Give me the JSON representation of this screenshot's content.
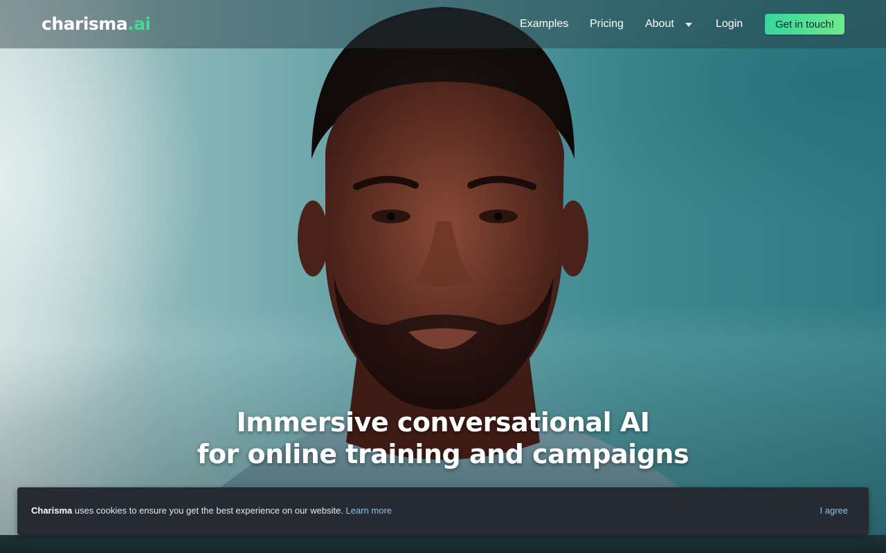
{
  "brand": {
    "name_main": "charisma",
    "name_dot": ".",
    "name_suffix": "ai"
  },
  "nav": {
    "items": [
      {
        "label": "Examples"
      },
      {
        "label": "Pricing"
      },
      {
        "label": "About"
      },
      {
        "label": "Login"
      }
    ],
    "cta_label": "Get in touch!"
  },
  "hero": {
    "headline_line1": "Immersive conversational AI",
    "headline_line2": "for online training and campaigns"
  },
  "cookie_banner": {
    "brand": "Charisma",
    "message": " uses cookies to ensure you get the best experience on our website. ",
    "learn_more": "Learn more",
    "agree": "I agree"
  },
  "colors": {
    "accent": "#47d69a",
    "cta_gradient_start": "#35d6a0",
    "cta_gradient_end": "#6fe88b",
    "banner_bg": "#262a33",
    "link": "#8fc3e8"
  }
}
